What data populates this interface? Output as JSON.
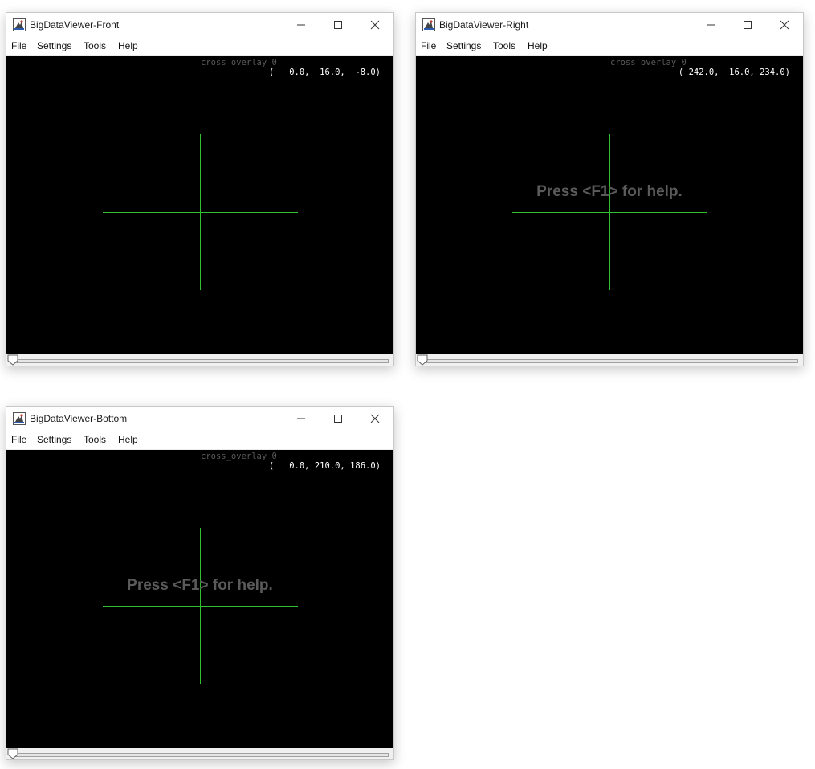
{
  "windows": [
    {
      "id": "front",
      "title": "BigDataViewer-Front",
      "menu": [
        "File",
        "Settings",
        "Tools",
        "Help"
      ],
      "overlay_name": "cross_overlay 0",
      "coordinates": "(   0.0,  16.0,  -8.0)",
      "help_text": "",
      "time_slider_position": 0
    },
    {
      "id": "right",
      "title": "BigDataViewer-Right",
      "menu": [
        "File",
        "Settings",
        "Tools",
        "Help"
      ],
      "overlay_name": "cross_overlay 0",
      "coordinates": "( 242.0,  16.0, 234.0)",
      "help_text": "Press <F1> for help.",
      "time_slider_position": 0
    },
    {
      "id": "bottom",
      "title": "BigDataViewer-Bottom",
      "menu": [
        "File",
        "Settings",
        "Tools",
        "Help"
      ],
      "overlay_name": "cross_overlay 0",
      "coordinates": "(   0.0, 210.0, 186.0)",
      "help_text": "Press <F1> for help.",
      "time_slider_position": 0
    }
  ],
  "colors": {
    "crosshair": "#2ec02e",
    "viewer_background": "#000000",
    "overlay_text": "#5a5a5a",
    "coordinate_text": "#ffffff"
  },
  "icons": {
    "app": "java-cup-icon",
    "minimize": "minimize-icon",
    "maximize": "maximize-icon",
    "close": "close-icon",
    "slider_thumb": "slider-thumb-icon"
  }
}
